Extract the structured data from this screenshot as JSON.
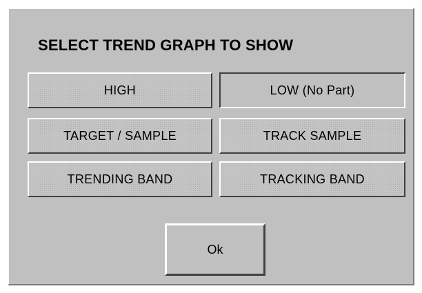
{
  "dialog": {
    "title": "SELECT TREND GRAPH TO SHOW",
    "options": [
      {
        "label": "HIGH",
        "state": "raised"
      },
      {
        "label": "LOW (No Part)",
        "state": "pressed"
      },
      {
        "label": "TARGET / SAMPLE",
        "state": "raised"
      },
      {
        "label": "TRACK SAMPLE",
        "state": "raised"
      },
      {
        "label": "TRENDING BAND",
        "state": "raised"
      },
      {
        "label": "TRACKING BAND",
        "state": "raised"
      }
    ],
    "ok_label": "Ok"
  },
  "colors": {
    "dialog_face": "#c0c0c0",
    "highlight": "#ffffff",
    "shadow": "#404040",
    "text": "#000000"
  }
}
